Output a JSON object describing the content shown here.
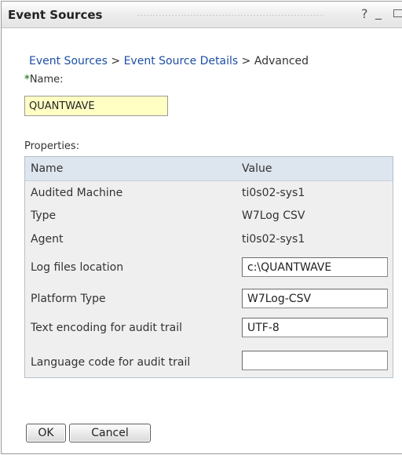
{
  "window": {
    "title": "Event Sources",
    "help_glyph": "?",
    "minimize_glyph": "_"
  },
  "breadcrumb": {
    "items": [
      "Event Sources",
      "Event Source Details"
    ],
    "separator": ">",
    "current": "Advanced"
  },
  "name_field": {
    "required_marker": "*",
    "label": "Name:",
    "value": "QUANTWAVE"
  },
  "properties": {
    "label": "Properties:",
    "columns": [
      "Name",
      "Value"
    ],
    "rows": [
      {
        "name": "Audited Machine",
        "value": "ti0s02-sys1"
      },
      {
        "name": "Type",
        "value": "W7Log CSV"
      },
      {
        "name": "Agent",
        "value": "ti0s02-sys1"
      },
      {
        "name": "Log files location",
        "value": "c:\\QUANTWAVE"
      },
      {
        "name": "Platform Type",
        "value": "W7Log-CSV"
      },
      {
        "name": "Text encoding for audit trail",
        "value": "UTF-8"
      },
      {
        "name": "Language code for audit trail",
        "value": ""
      }
    ]
  },
  "buttons": {
    "ok": "OK",
    "cancel": "Cancel"
  },
  "colors": {
    "link": "#1d4fa5",
    "required_star": "#3d8b3d",
    "name_input_bg": "#ffffc4",
    "table_header_bg": "#dde5ee",
    "table_bg": "#efefef"
  }
}
